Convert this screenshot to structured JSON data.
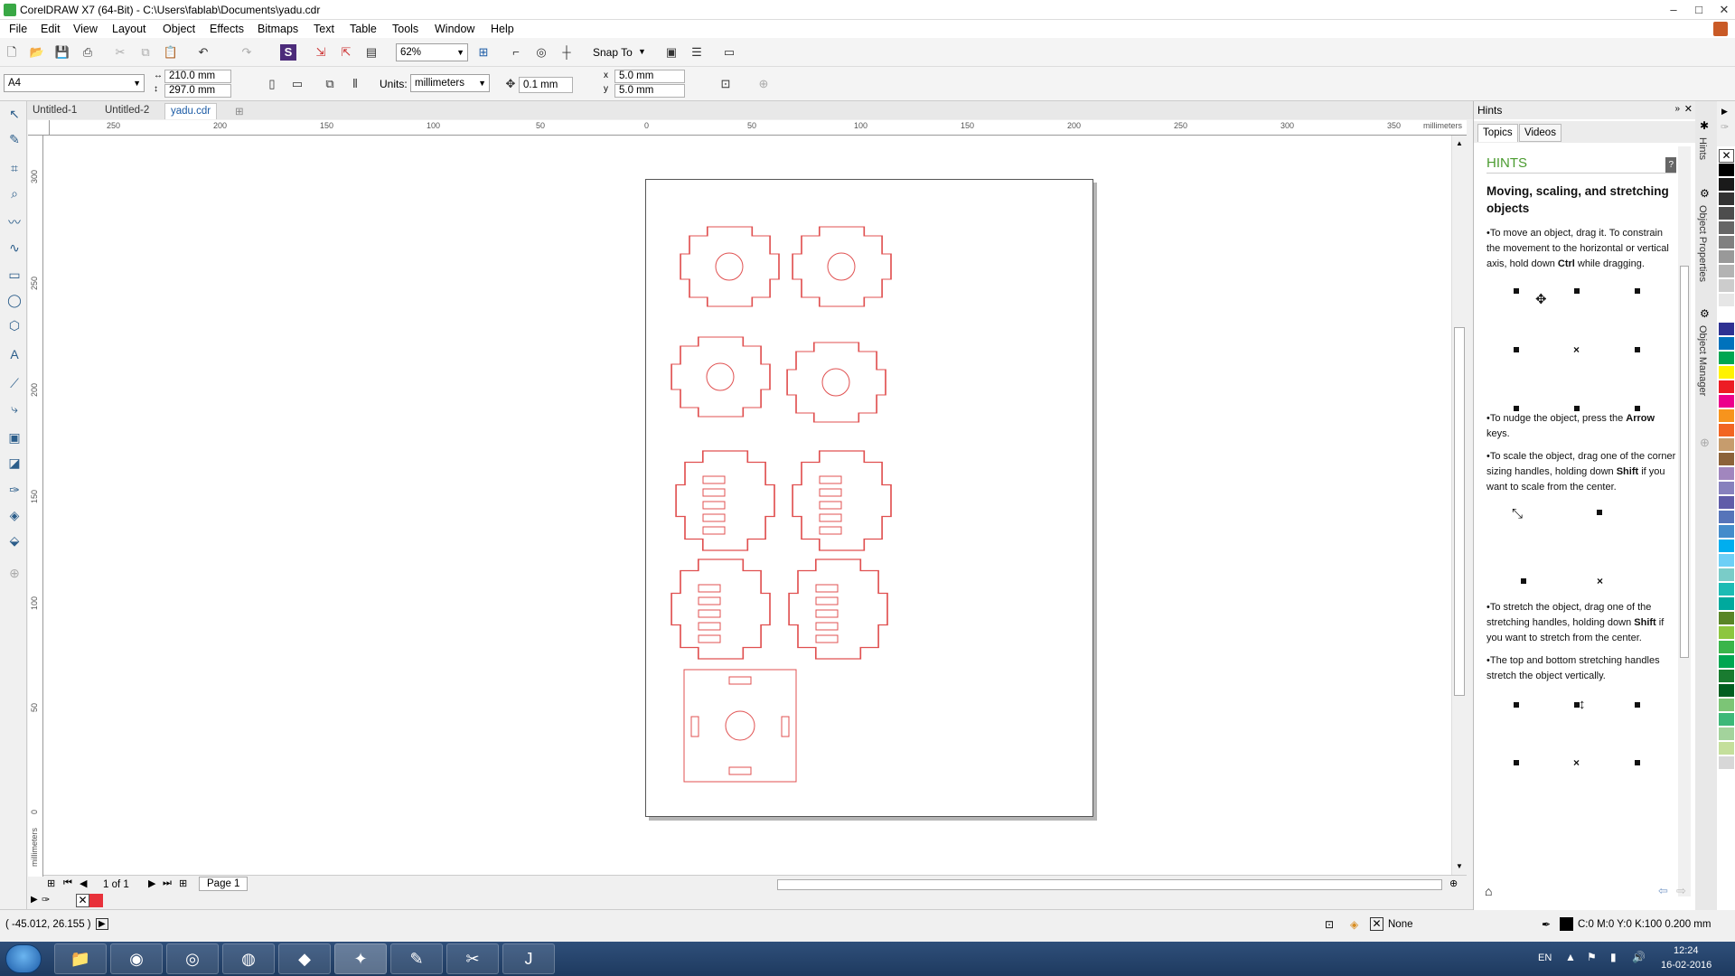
{
  "window": {
    "title": "CorelDRAW X7 (64-Bit) - C:\\Users\\fablab\\Documents\\yadu.cdr",
    "min": "–",
    "max": "□",
    "close": "✕"
  },
  "menu": [
    "File",
    "Edit",
    "View",
    "Layout",
    "Object",
    "Effects",
    "Bitmaps",
    "Text",
    "Table",
    "Tools",
    "Window",
    "Help"
  ],
  "toolbar": {
    "zoom": "62%",
    "snap_to": "Snap To"
  },
  "propbar": {
    "page_size": "A4",
    "width": "210.0 mm",
    "height": "297.0 mm",
    "units_label": "Units:",
    "units": "millimeters",
    "nudge": "0.1 mm",
    "dup_x": "5.0 mm",
    "dup_y": "5.0 mm"
  },
  "doc_tabs": [
    "Untitled-1",
    "Untitled-2",
    "yadu.cdr"
  ],
  "active_tab": 2,
  "ruler": {
    "h_labels": [
      "250",
      "200",
      "150",
      "100",
      "50",
      "0",
      "50",
      "100",
      "150",
      "200",
      "250",
      "300",
      "350"
    ],
    "h_unit": "millimeters",
    "v_labels": [
      "300",
      "250",
      "200",
      "150",
      "100",
      "50",
      "0"
    ],
    "v_unit": "millimeters"
  },
  "navigation": {
    "page_count": "1 of 1",
    "page_tab": "Page 1"
  },
  "status": {
    "coords": "( -45.012, 26.155 )",
    "fill": "None",
    "outline": "C:0 M:0 Y:0 K:100  0.200 mm"
  },
  "hints_panel": {
    "title": "Hints",
    "tabs": [
      "Topics",
      "Videos"
    ],
    "heading": "HINTS",
    "subheading": "Moving, scaling, and stretching objects",
    "p1_a": "To move an object, drag it. To constrain the movement to the horizontal or vertical axis, hold down ",
    "p1_b": "Ctrl",
    "p1_c": " while dragging.",
    "p2_a": "To nudge the object, press the ",
    "p2_b": "Arrow",
    "p2_c": " keys.",
    "p3_a": "To scale the object, drag one of the corner sizing handles, holding down ",
    "p3_b": "Shift",
    "p3_c": " if you want to scale from the center.",
    "p4_a": "To stretch the object, drag one of the stretching handles, holding down ",
    "p4_b": "Shift",
    "p4_c": " if you want to stretch from the center.",
    "p5": "The top and bottom stretching handles stretch the object vertically."
  },
  "side_tabs": [
    "Hints",
    "Object Properties",
    "Object Manager"
  ],
  "palette_colors": [
    "#000000",
    "#1a1a1a",
    "#333333",
    "#4d4d4d",
    "#666666",
    "#808080",
    "#999999",
    "#b3b3b3",
    "#cccccc",
    "#e6e6e6",
    "#ffffff",
    "#2e3192",
    "#0072bc",
    "#00a651",
    "#fff200",
    "#ed1c24",
    "#ec008c",
    "#f7941d",
    "#f26522",
    "#c69c6d",
    "#8c6239",
    "#a186be",
    "#8781bd",
    "#605ca8",
    "#5674b9",
    "#448ccb",
    "#00aeef",
    "#6dcff6",
    "#7accc8",
    "#1cbbb4",
    "#00a99d",
    "#598527",
    "#8dc63f",
    "#39b54a",
    "#00a651",
    "#197b30",
    "#005e20",
    "#7cc576",
    "#3cb878",
    "#a3d39c",
    "#c4df9b",
    "#d7d7d7"
  ],
  "taskbar": {
    "language": "EN",
    "time": "12:24",
    "date": "16-02-2016"
  },
  "colors": {
    "accent": "#e8313a",
    "cut_line": "#e05050",
    "hint_green": "#4a9b2f"
  }
}
